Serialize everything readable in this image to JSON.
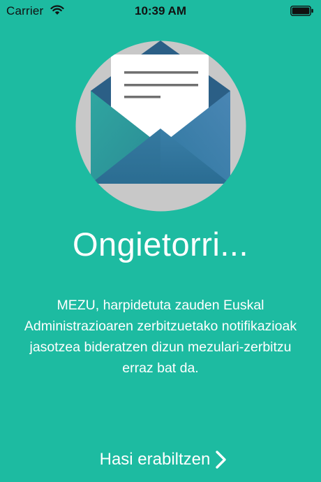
{
  "status_bar": {
    "carrier": "Carrier",
    "time": "10:39 AM",
    "wifi_icon": "wifi-icon",
    "battery_icon": "battery-icon"
  },
  "welcome": {
    "title": "Ongietorri...",
    "description": "MEZU, harpidetuta zauden Euskal Administrazioaren zerbitzuetako notifikazioak jasotzea bideratzen dizun mezulari-zerbitzu erraz bat da.",
    "illustration_icon": "envelope-icon"
  },
  "actions": {
    "start_label": "Hasi erabiltzen",
    "start_icon": "chevron-right-icon"
  },
  "colors": {
    "background": "#1dbba1",
    "text": "#ffffff",
    "circle": "#c8c8c8",
    "envelope_dark": "#2b5f86",
    "envelope_teal": "#2a9a96",
    "paper": "#ffffff"
  }
}
